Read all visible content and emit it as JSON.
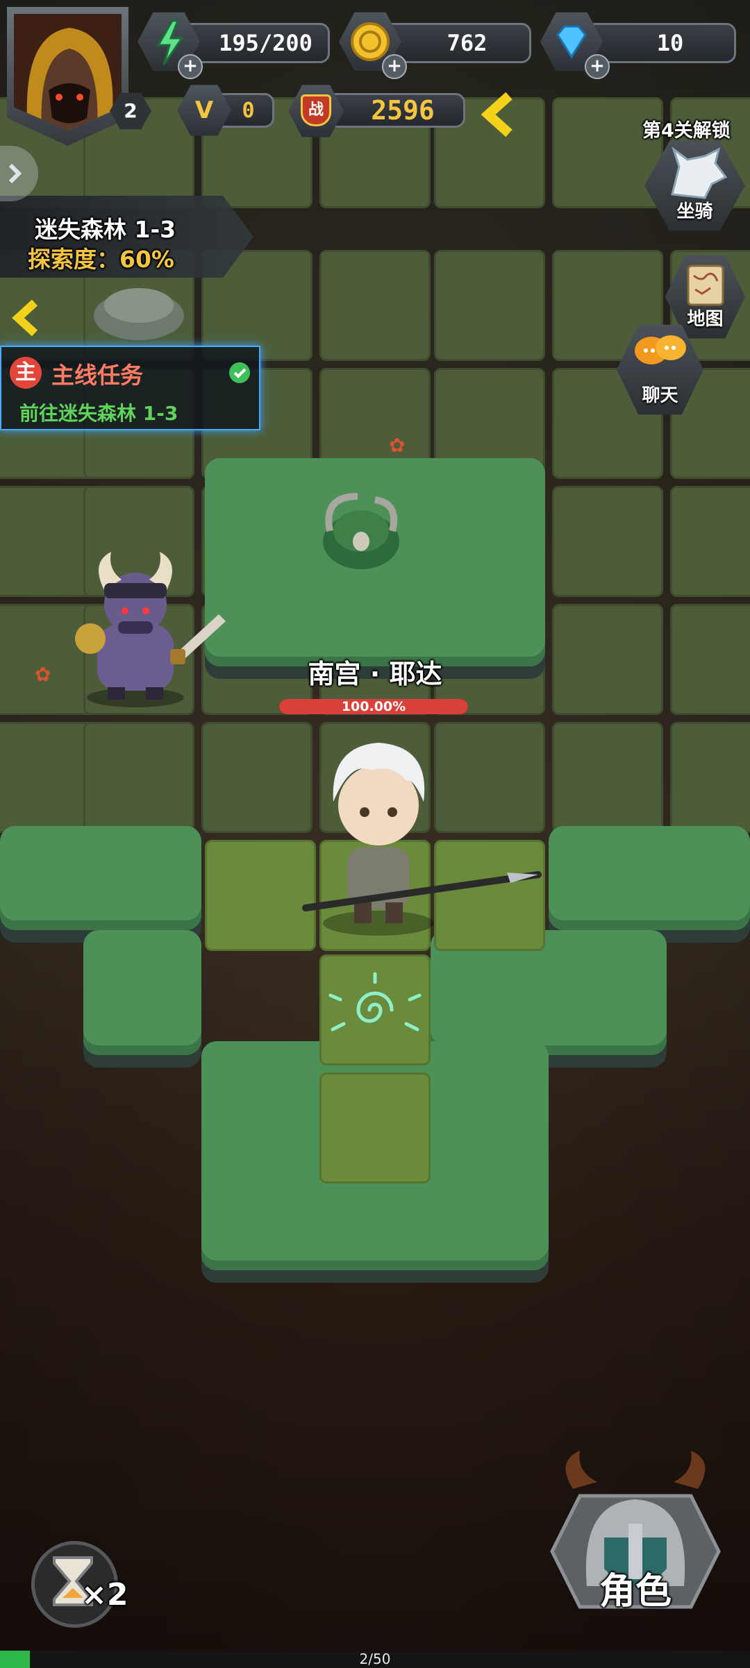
{
  "hud": {
    "level": "2",
    "energy": "195/200",
    "gold": "762",
    "diamonds": "10",
    "vip": "0",
    "power_badge": "战",
    "power": "2596"
  },
  "stage": {
    "name": "迷失森林 1-3",
    "explore_label": "探索度：",
    "explore_value": "60%"
  },
  "quest": {
    "badge": "主",
    "title": "主线任务",
    "desc": "前往迷失森林 1-3"
  },
  "side_buttons": {
    "unlock_note": "第4关解锁",
    "mount": "坐骑",
    "map": "地图",
    "chat": "聊天"
  },
  "hero": {
    "name": "南宫 · 耶达",
    "hp_text": "100.00%",
    "hp_fraction": 1.0
  },
  "bottom": {
    "speed": "×2",
    "role_label": "角色",
    "progress_text": "2/50",
    "progress_fraction": 0.04
  },
  "colors": {
    "gold_text": "#f5c542",
    "quest_green": "#5fd35a",
    "hp_red": "#d9403a",
    "progress_green": "#2fb84a"
  }
}
